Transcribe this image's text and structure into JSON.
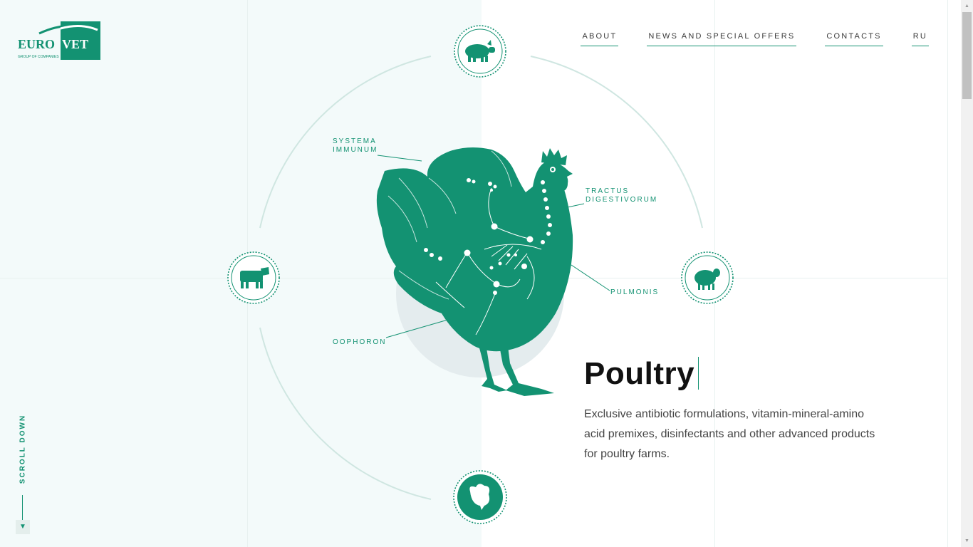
{
  "brand": {
    "logo_euro": "EURO",
    "logo_vet": "VET",
    "logo_sub": "GROUP OF COMPANIES",
    "accent": "#139272"
  },
  "nav": [
    {
      "label": "ABOUT"
    },
    {
      "label": "NEWS AND SPECIAL OFFERS"
    },
    {
      "label": "CONTACTS"
    },
    {
      "label": "RU"
    }
  ],
  "animals": [
    {
      "name": "pig",
      "icon": "pig-icon"
    },
    {
      "name": "cow",
      "icon": "cow-icon"
    },
    {
      "name": "sheep",
      "icon": "sheep-icon"
    },
    {
      "name": "poultry",
      "icon": "chicken-icon",
      "active": true
    }
  ],
  "annotations": {
    "immune_1": "SYSTEMA",
    "immune_2": "IMMUNUM",
    "digestive_1": "TRACTUS",
    "digestive_2": "DIGESTIVORUM",
    "lungs": "PULMONIS",
    "ovary": "OOPHORON"
  },
  "content": {
    "title": "Poultry",
    "description": "Exclusive antibiotic formulations, vitamin-mineral-amino acid premixes, disinfectants and other advanced products for poultry farms."
  },
  "scroll_hint": "SCROLL DOWN"
}
